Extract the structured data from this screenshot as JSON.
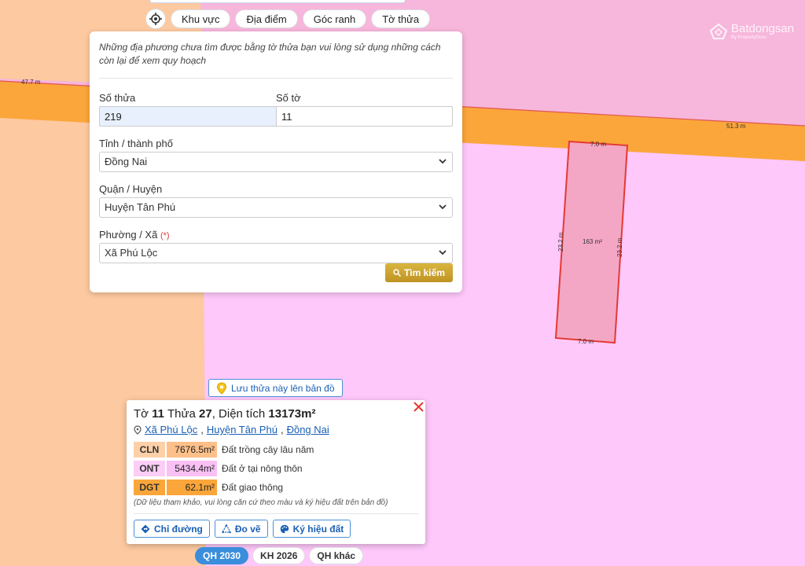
{
  "top_tabs": [
    "Khu vực",
    "Địa điểm",
    "Góc ranh",
    "Tờ thửa"
  ],
  "search_panel": {
    "note": "Những địa phương chưa tìm được bằng tờ thửa bạn vui lòng sử dụng những cách còn lại để xem quy hoạch",
    "parcel_label": "Số thửa",
    "parcel_value": "219",
    "sheet_label": "Số tờ",
    "sheet_value": "11",
    "province_label": "Tỉnh / thành phố",
    "province_value": "Đồng Nai",
    "district_label": "Quận / Huyện",
    "district_value": "Huyện Tân Phú",
    "ward_label": "Phường / Xã",
    "ward_required": "(*)",
    "ward_value": "Xã Phú Lộc",
    "search_button": "Tìm kiếm"
  },
  "map": {
    "road_labels": [
      "47.7 m",
      "51.3 m"
    ],
    "plot": {
      "top": "7.0 m",
      "bottom": "7.0 m",
      "left": "23.2 m",
      "right": "23.2 m",
      "area": "163 m²"
    },
    "colors": {
      "cln": "#fdc9a0",
      "ont": "#fec8fa",
      "dgt": "#fba63a",
      "background": "#f7b6dc",
      "plot_fill": "#f4a7c4",
      "plot_border": "#e53935"
    }
  },
  "save_button": "Lưu thửa này lên bản đồ",
  "info_card": {
    "title_prefix": "Tờ",
    "sheet": "11",
    "parcel_word": "Thửa",
    "parcel": "27",
    "area_word": ", Diện tích",
    "area": "13173m²",
    "address": [
      "Xã Phú Lộc",
      "Huyện Tân Phú",
      "Đồng Nai"
    ],
    "land_uses": [
      {
        "code": "CLN",
        "area": "7676.5m²",
        "desc": "Đất trồng cây lâu năm",
        "color": "#fdd0a8",
        "area_color": "#fdc08a"
      },
      {
        "code": "ONT",
        "area": "5434.4m²",
        "desc": "Đất ở tại nông thôn",
        "color": "#fbcdf7",
        "area_color": "#f9c0f4"
      },
      {
        "code": "DGT",
        "area": "62.1m²",
        "desc": "Đất giao thông",
        "color": "#fba63a",
        "area_color": "#fba63a"
      }
    ],
    "note": "(Dữ liệu tham khảo, vui lòng căn cứ theo màu và ký hiệu đất trên bản đồ)",
    "actions": [
      "Chỉ đường",
      "Đo vẽ",
      "Ký hiệu đất"
    ]
  },
  "bottom_tabs": [
    "QH 2030",
    "KH 2026",
    "QH khác"
  ],
  "logo": {
    "name": "Batdongsan",
    "sub": "By PropertyGuru"
  }
}
